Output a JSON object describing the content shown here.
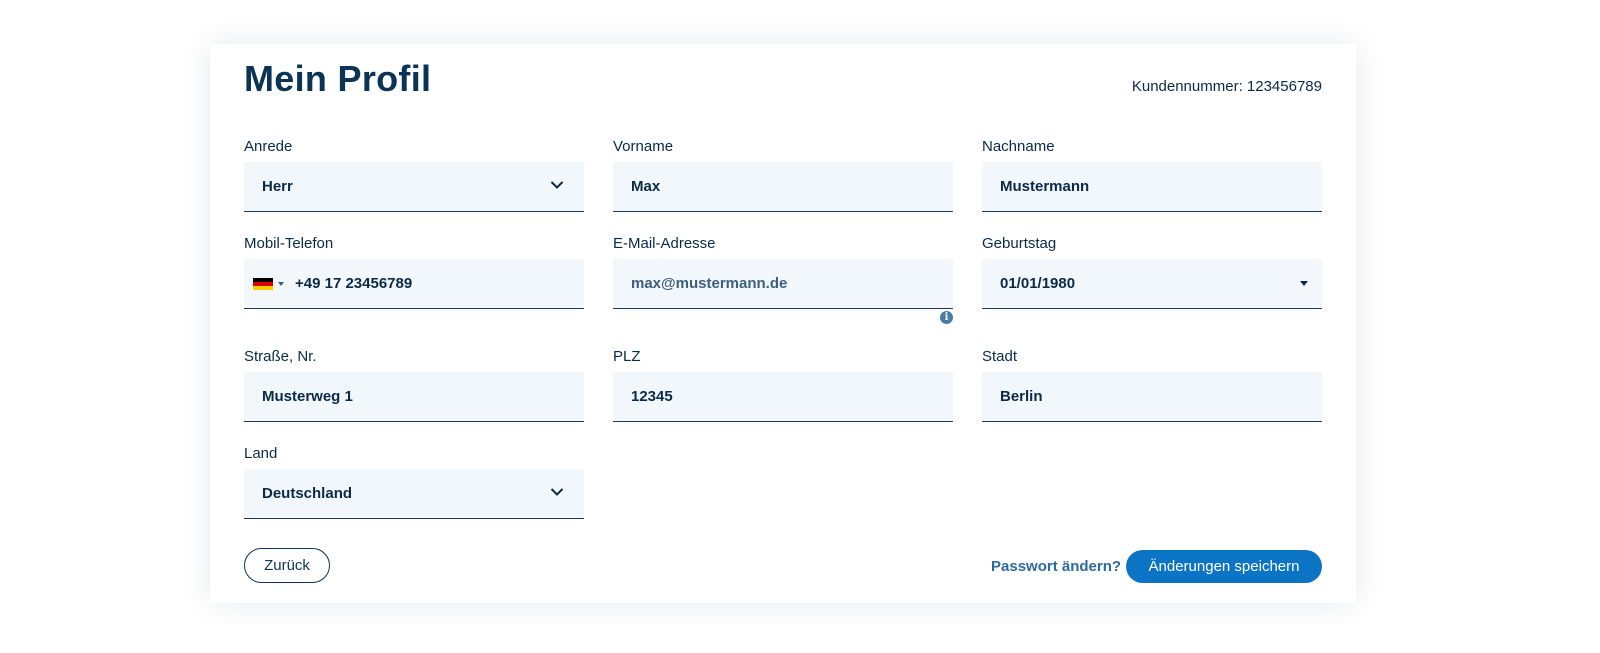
{
  "page": {
    "title": "Mein Profil",
    "customer_number": "Kundennummer: 123456789"
  },
  "fields": {
    "salutation": {
      "label": "Anrede",
      "value": "Herr"
    },
    "first_name": {
      "label": "Vorname",
      "value": "Max"
    },
    "last_name": {
      "label": "Nachname",
      "value": "Mustermann"
    },
    "mobile": {
      "label": "Mobil-Telefon",
      "value": "+49 17 23456789",
      "country_flag": "germany-flag"
    },
    "email": {
      "label": "E-Mail-Adresse",
      "value": "max@mustermann.de"
    },
    "birthday": {
      "label": "Geburtstag",
      "value": "01/01/1980"
    },
    "street": {
      "label": "Straße, Nr.",
      "value": "Musterweg 1"
    },
    "zip": {
      "label": "PLZ",
      "value": "12345"
    },
    "city": {
      "label": "Stadt",
      "value": "Berlin"
    },
    "country": {
      "label": "Land",
      "value": "Deutschland"
    }
  },
  "actions": {
    "back_label": "Zurück",
    "change_password_label": "Passwort ändern?",
    "save_label": "Änderungen speichern"
  },
  "icons": {
    "info": "info-icon",
    "chevron": "chevron-down-icon"
  },
  "colors": {
    "primary": "#0b74c4",
    "heading": "#0a3356",
    "field_bg": "#f2f7fb",
    "link": "#2d6b9e"
  }
}
